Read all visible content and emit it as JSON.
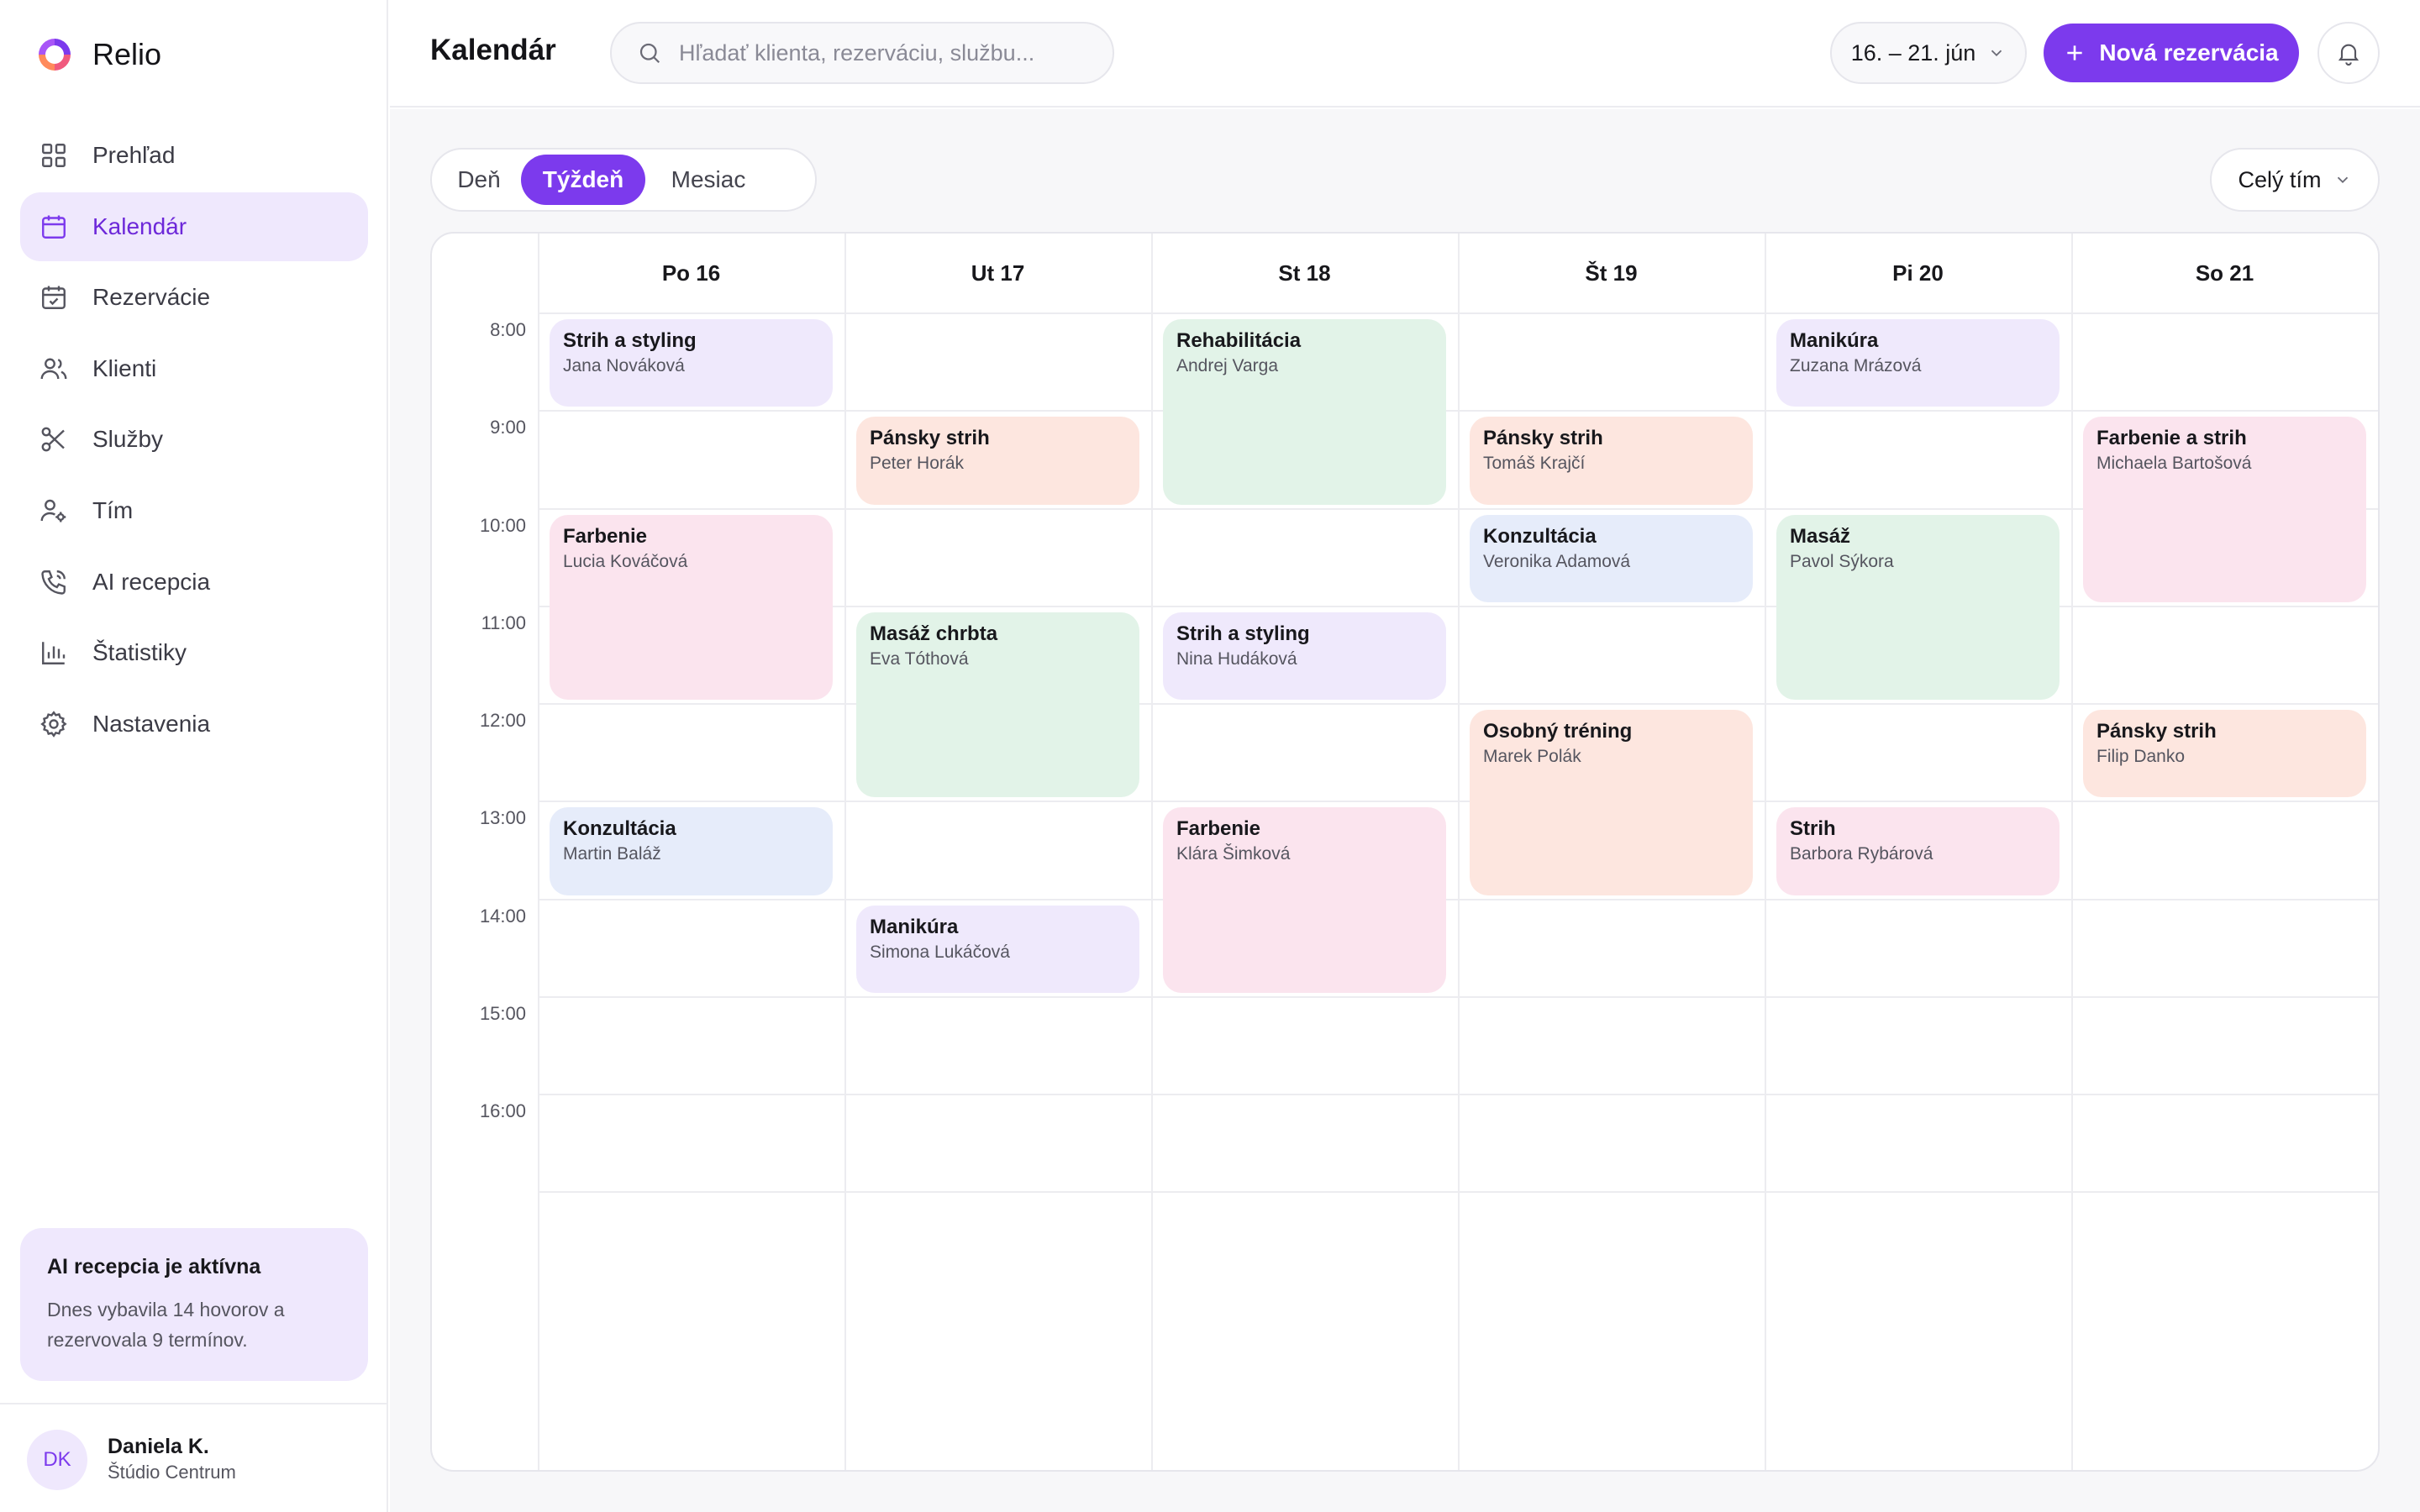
{
  "app": {
    "name": "Relio"
  },
  "sidebar": {
    "items": [
      {
        "label": "Prehľad",
        "icon": "grid-icon",
        "active": false
      },
      {
        "label": "Kalendár",
        "icon": "calendar-icon",
        "active": true
      },
      {
        "label": "Rezervácie",
        "icon": "calendar-check-icon",
        "active": false
      },
      {
        "label": "Klienti",
        "icon": "users-icon",
        "active": false
      },
      {
        "label": "Služby",
        "icon": "scissors-icon",
        "active": false
      },
      {
        "label": "Tím",
        "icon": "team-icon",
        "active": false
      },
      {
        "label": "AI recepcia",
        "icon": "phone-icon",
        "active": false
      },
      {
        "label": "Štatistiky",
        "icon": "bar-chart-icon",
        "active": false
      },
      {
        "label": "Nastavenia",
        "icon": "gear-icon",
        "active": false
      }
    ],
    "promo": {
      "title": "AI recepcia je aktívna",
      "text": "Dnes vybavila 14 hovorov a rezervovala 9 termínov."
    },
    "user": {
      "initials": "DK",
      "name": "Daniela K.",
      "business": "Štúdio Centrum"
    }
  },
  "header": {
    "title": "Kalendár",
    "search_placeholder": "Hľadať klienta, rezerváciu, službu...",
    "date_range": "16. – 21. jún",
    "new_button": "Nová rezervácia"
  },
  "toolbar": {
    "views": [
      {
        "label": "Deň",
        "active": false
      },
      {
        "label": "Týždeň",
        "active": true
      },
      {
        "label": "Mesiac",
        "active": false
      }
    ],
    "team_filter": "Celý tím"
  },
  "calendar": {
    "days": [
      "Po 16",
      "Ut 17",
      "St 18",
      "Št 19",
      "Pi 20",
      "So 21"
    ],
    "hours": [
      "8:00",
      "9:00",
      "10:00",
      "11:00",
      "12:00",
      "13:00",
      "14:00",
      "15:00",
      "16:00"
    ],
    "colors": {
      "purple": "#efe9fc",
      "peach": "#fde6df",
      "green": "#e2f3e8",
      "pink": "#fbe4ee",
      "blue": "#e6ecfa"
    },
    "events": [
      {
        "day": 0,
        "start": 8,
        "end": 9,
        "title": "Strih a styling",
        "client": "Jana Nováková",
        "color": "purple"
      },
      {
        "day": 0,
        "start": 10,
        "end": 12,
        "title": "Farbenie",
        "client": "Lucia Kováčová",
        "color": "pink"
      },
      {
        "day": 0,
        "start": 13,
        "end": 14,
        "title": "Konzultácia",
        "client": "Martin Baláž",
        "color": "blue"
      },
      {
        "day": 1,
        "start": 9,
        "end": 10,
        "title": "Pánsky strih",
        "client": "Peter Horák",
        "color": "peach"
      },
      {
        "day": 1,
        "start": 11,
        "end": 13,
        "title": "Masáž chrbta",
        "client": "Eva Tóthová",
        "color": "green"
      },
      {
        "day": 1,
        "start": 14,
        "end": 15,
        "title": "Manikúra",
        "client": "Simona Lukáčová",
        "color": "purple"
      },
      {
        "day": 2,
        "start": 8,
        "end": 10,
        "title": "Rehabilitácia",
        "client": "Andrej Varga",
        "color": "green"
      },
      {
        "day": 2,
        "start": 11,
        "end": 12,
        "title": "Strih a styling",
        "client": "Nina Hudáková",
        "color": "purple"
      },
      {
        "day": 2,
        "start": 13,
        "end": 15,
        "title": "Farbenie",
        "client": "Klára Šimková",
        "color": "pink"
      },
      {
        "day": 3,
        "start": 9,
        "end": 10,
        "title": "Pánsky strih",
        "client": "Tomáš Krajčí",
        "color": "peach"
      },
      {
        "day": 3,
        "start": 10,
        "end": 11,
        "title": "Konzultácia",
        "client": "Veronika Adamová",
        "color": "blue"
      },
      {
        "day": 3,
        "start": 12,
        "end": 14,
        "title": "Osobný tréning",
        "client": "Marek Polák",
        "color": "peach"
      },
      {
        "day": 4,
        "start": 8,
        "end": 9,
        "title": "Manikúra",
        "client": "Zuzana Mrázová",
        "color": "purple"
      },
      {
        "day": 4,
        "start": 10,
        "end": 12,
        "title": "Masáž",
        "client": "Pavol Sýkora",
        "color": "green"
      },
      {
        "day": 4,
        "start": 13,
        "end": 14,
        "title": "Strih",
        "client": "Barbora Rybárová",
        "color": "pink"
      },
      {
        "day": 5,
        "start": 9,
        "end": 11,
        "title": "Farbenie a strih",
        "client": "Michaela Bartošová",
        "color": "pink"
      },
      {
        "day": 5,
        "start": 12,
        "end": 13,
        "title": "Pánsky strih",
        "client": "Filip Danko",
        "color": "peach"
      }
    ]
  },
  "theme": {
    "accent": "#7c3aed",
    "accent_soft": "#efe8fd"
  }
}
